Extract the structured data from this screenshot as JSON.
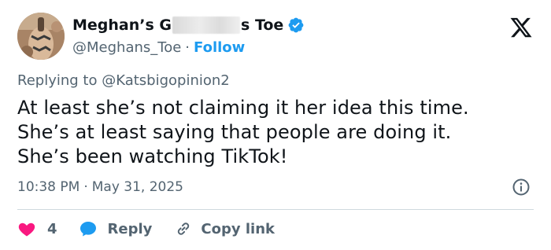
{
  "author": {
    "name_start": "Meghan’s G",
    "name_end": "s Toe",
    "handle": "@Meghans_Toe",
    "separator": "·",
    "follow_label": "Follow"
  },
  "replying": {
    "prefix": "Replying to",
    "mention": "@Katsbigopinion2"
  },
  "tweet": {
    "lines": [
      "At least she’s not claiming it her idea this time.",
      "She’s at least saying that people are doing it.",
      "She’s been watching TikTok!"
    ],
    "time": "10:38 PM",
    "separator": "·",
    "date": "May 31, 2025"
  },
  "actions": {
    "like_count": "4",
    "reply_label": "Reply",
    "copy_label": "Copy link"
  },
  "icons": {
    "verified": "verified-badge-icon",
    "brand": "x-logo-icon",
    "info": "info-icon",
    "like": "heart-icon",
    "reply": "speech-bubble-icon",
    "copy": "link-icon"
  },
  "colors": {
    "accent": "#1d9bf0",
    "like": "#f91880",
    "text": "#0f1419",
    "secondary": "#536471",
    "divider": "#cfd9de"
  }
}
